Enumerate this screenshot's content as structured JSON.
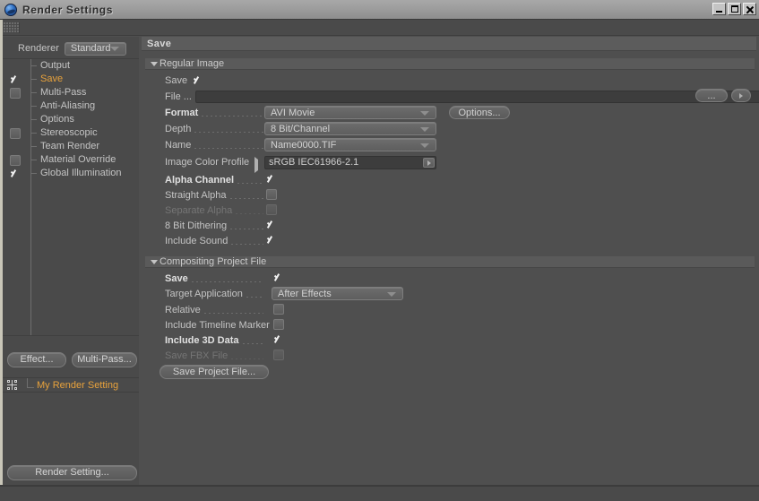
{
  "window": {
    "title": "Render Settings",
    "icon": "c4d-sphere-icon",
    "buttons": {
      "minimize": "minimize-icon",
      "maximize": "maximize-icon",
      "close": "close-icon"
    }
  },
  "sidebar": {
    "renderer": {
      "label": "Renderer",
      "value": "Standard"
    },
    "tree": [
      {
        "label": "Output",
        "checkbox": "none",
        "selected": false
      },
      {
        "label": "Save",
        "checkbox": "checked",
        "selected": true
      },
      {
        "label": "Multi-Pass",
        "checkbox": "unchecked",
        "selected": false
      },
      {
        "label": "Anti-Aliasing",
        "checkbox": "none",
        "selected": false
      },
      {
        "label": "Options",
        "checkbox": "none",
        "selected": false
      },
      {
        "label": "Stereoscopic",
        "checkbox": "unchecked",
        "selected": false
      },
      {
        "label": "Team Render",
        "checkbox": "none",
        "selected": false
      },
      {
        "label": "Material Override",
        "checkbox": "unchecked",
        "selected": false
      },
      {
        "label": "Global Illumination",
        "checkbox": "checked",
        "selected": false
      }
    ],
    "effect_button": "Effect...",
    "multipass_button": "Multi-Pass...",
    "render_setting_name": "My Render Setting",
    "render_setting_button": "Render Setting..."
  },
  "panel": {
    "header": "Save",
    "regular_image": {
      "group_label": "Regular Image",
      "save": {
        "label": "Save",
        "checked": true,
        "bold": false
      },
      "file": {
        "label": "File ...",
        "value": "",
        "browse_button": "...",
        "arrow_button": "play-arrow-icon"
      },
      "format": {
        "label": "Format",
        "value": "AVI Movie",
        "bold": true
      },
      "options_button": "Options...",
      "depth": {
        "label": "Depth",
        "value": "8 Bit/Channel"
      },
      "name": {
        "label": "Name",
        "value": "Name0000.TIF"
      },
      "color_profile": {
        "label": "Image Color Profile",
        "value": "sRGB IEC61966-2.1"
      },
      "checkboxes": [
        {
          "label": "Alpha Channel",
          "checked": true,
          "bold": true,
          "disabled": false
        },
        {
          "label": "Straight Alpha",
          "checked": false,
          "bold": false,
          "disabled": false
        },
        {
          "label": "Separate Alpha",
          "checked": false,
          "bold": false,
          "disabled": true
        },
        {
          "label": "8 Bit Dithering",
          "checked": true,
          "bold": false,
          "disabled": false
        },
        {
          "label": "Include Sound",
          "checked": true,
          "bold": false,
          "disabled": false
        }
      ]
    },
    "compositing": {
      "group_label": "Compositing Project File",
      "save": {
        "label": "Save",
        "checked": true,
        "bold": true
      },
      "target_application": {
        "label": "Target Application",
        "value": "After Effects"
      },
      "checkboxes": [
        {
          "label": "Relative",
          "checked": false,
          "bold": false,
          "disabled": false
        },
        {
          "label": "Include Timeline Marker",
          "checked": false,
          "bold": false,
          "disabled": false
        },
        {
          "label": "Include 3D Data",
          "checked": true,
          "bold": true,
          "disabled": false
        },
        {
          "label": "Save FBX File",
          "checked": false,
          "bold": false,
          "disabled": true
        }
      ],
      "save_project_button": "Save Project File..."
    }
  },
  "colors": {
    "accent_orange": "#e8a23c",
    "panel_bg": "#4f4f4f",
    "sidebar_bg": "#4a4a4a",
    "titlebar": "#9d9d9d",
    "edge_highlight": "#c9c6b8"
  }
}
